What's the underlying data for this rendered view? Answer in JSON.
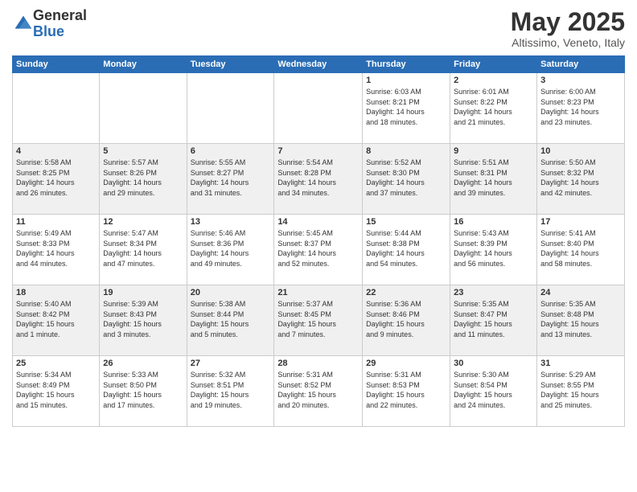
{
  "logo": {
    "line1": "General",
    "line2": "Blue"
  },
  "title": "May 2025",
  "subtitle": "Altissimo, Veneto, Italy",
  "days_of_week": [
    "Sunday",
    "Monday",
    "Tuesday",
    "Wednesday",
    "Thursday",
    "Friday",
    "Saturday"
  ],
  "weeks": [
    [
      {
        "day": "",
        "info": ""
      },
      {
        "day": "",
        "info": ""
      },
      {
        "day": "",
        "info": ""
      },
      {
        "day": "",
        "info": ""
      },
      {
        "day": "1",
        "info": "Sunrise: 6:03 AM\nSunset: 8:21 PM\nDaylight: 14 hours\nand 18 minutes."
      },
      {
        "day": "2",
        "info": "Sunrise: 6:01 AM\nSunset: 8:22 PM\nDaylight: 14 hours\nand 21 minutes."
      },
      {
        "day": "3",
        "info": "Sunrise: 6:00 AM\nSunset: 8:23 PM\nDaylight: 14 hours\nand 23 minutes."
      }
    ],
    [
      {
        "day": "4",
        "info": "Sunrise: 5:58 AM\nSunset: 8:25 PM\nDaylight: 14 hours\nand 26 minutes."
      },
      {
        "day": "5",
        "info": "Sunrise: 5:57 AM\nSunset: 8:26 PM\nDaylight: 14 hours\nand 29 minutes."
      },
      {
        "day": "6",
        "info": "Sunrise: 5:55 AM\nSunset: 8:27 PM\nDaylight: 14 hours\nand 31 minutes."
      },
      {
        "day": "7",
        "info": "Sunrise: 5:54 AM\nSunset: 8:28 PM\nDaylight: 14 hours\nand 34 minutes."
      },
      {
        "day": "8",
        "info": "Sunrise: 5:52 AM\nSunset: 8:30 PM\nDaylight: 14 hours\nand 37 minutes."
      },
      {
        "day": "9",
        "info": "Sunrise: 5:51 AM\nSunset: 8:31 PM\nDaylight: 14 hours\nand 39 minutes."
      },
      {
        "day": "10",
        "info": "Sunrise: 5:50 AM\nSunset: 8:32 PM\nDaylight: 14 hours\nand 42 minutes."
      }
    ],
    [
      {
        "day": "11",
        "info": "Sunrise: 5:49 AM\nSunset: 8:33 PM\nDaylight: 14 hours\nand 44 minutes."
      },
      {
        "day": "12",
        "info": "Sunrise: 5:47 AM\nSunset: 8:34 PM\nDaylight: 14 hours\nand 47 minutes."
      },
      {
        "day": "13",
        "info": "Sunrise: 5:46 AM\nSunset: 8:36 PM\nDaylight: 14 hours\nand 49 minutes."
      },
      {
        "day": "14",
        "info": "Sunrise: 5:45 AM\nSunset: 8:37 PM\nDaylight: 14 hours\nand 52 minutes."
      },
      {
        "day": "15",
        "info": "Sunrise: 5:44 AM\nSunset: 8:38 PM\nDaylight: 14 hours\nand 54 minutes."
      },
      {
        "day": "16",
        "info": "Sunrise: 5:43 AM\nSunset: 8:39 PM\nDaylight: 14 hours\nand 56 minutes."
      },
      {
        "day": "17",
        "info": "Sunrise: 5:41 AM\nSunset: 8:40 PM\nDaylight: 14 hours\nand 58 minutes."
      }
    ],
    [
      {
        "day": "18",
        "info": "Sunrise: 5:40 AM\nSunset: 8:42 PM\nDaylight: 15 hours\nand 1 minute."
      },
      {
        "day": "19",
        "info": "Sunrise: 5:39 AM\nSunset: 8:43 PM\nDaylight: 15 hours\nand 3 minutes."
      },
      {
        "day": "20",
        "info": "Sunrise: 5:38 AM\nSunset: 8:44 PM\nDaylight: 15 hours\nand 5 minutes."
      },
      {
        "day": "21",
        "info": "Sunrise: 5:37 AM\nSunset: 8:45 PM\nDaylight: 15 hours\nand 7 minutes."
      },
      {
        "day": "22",
        "info": "Sunrise: 5:36 AM\nSunset: 8:46 PM\nDaylight: 15 hours\nand 9 minutes."
      },
      {
        "day": "23",
        "info": "Sunrise: 5:35 AM\nSunset: 8:47 PM\nDaylight: 15 hours\nand 11 minutes."
      },
      {
        "day": "24",
        "info": "Sunrise: 5:35 AM\nSunset: 8:48 PM\nDaylight: 15 hours\nand 13 minutes."
      }
    ],
    [
      {
        "day": "25",
        "info": "Sunrise: 5:34 AM\nSunset: 8:49 PM\nDaylight: 15 hours\nand 15 minutes."
      },
      {
        "day": "26",
        "info": "Sunrise: 5:33 AM\nSunset: 8:50 PM\nDaylight: 15 hours\nand 17 minutes."
      },
      {
        "day": "27",
        "info": "Sunrise: 5:32 AM\nSunset: 8:51 PM\nDaylight: 15 hours\nand 19 minutes."
      },
      {
        "day": "28",
        "info": "Sunrise: 5:31 AM\nSunset: 8:52 PM\nDaylight: 15 hours\nand 20 minutes."
      },
      {
        "day": "29",
        "info": "Sunrise: 5:31 AM\nSunset: 8:53 PM\nDaylight: 15 hours\nand 22 minutes."
      },
      {
        "day": "30",
        "info": "Sunrise: 5:30 AM\nSunset: 8:54 PM\nDaylight: 15 hours\nand 24 minutes."
      },
      {
        "day": "31",
        "info": "Sunrise: 5:29 AM\nSunset: 8:55 PM\nDaylight: 15 hours\nand 25 minutes."
      }
    ]
  ]
}
